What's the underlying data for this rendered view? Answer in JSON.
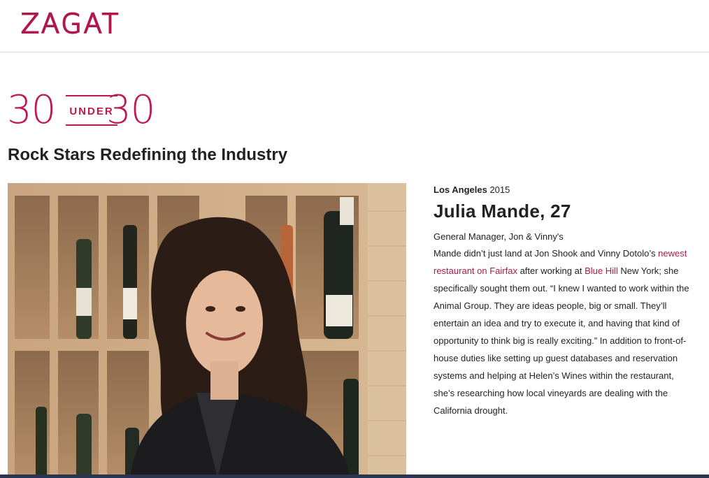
{
  "header": {
    "logo": "ZAGAT"
  },
  "badge": {
    "left_number": "30",
    "word": "UNDER",
    "right_number": "30"
  },
  "headline": "Rock Stars Redefining the Industry",
  "photo": {
    "icon": "portrait-photo"
  },
  "article": {
    "city": "Los Angeles",
    "year": "2015",
    "name": "Julia Mande, 27",
    "role": "General Manager, Jon & Vinny's",
    "body": {
      "p1": "Mande didn’t just land at Jon Shook and Vinny Dotolo’s ",
      "link1": "newest restaurant on Fairfax",
      "p2": " after working at ",
      "link2": "Blue Hill",
      "p3": " New York; she specifically sought them out. “I knew I wanted to work within the Animal Group. They are ideas people, big or small. They’ll entertain an idea and try to execute it, and having that kind of opportunity to think big is really exciting.” In addition to front-of-house duties like setting up guest databases and reservation systems and helping at Helen’s Wines within the restaurant, she’s researching how local vineyards are dealing with the California drought."
    }
  },
  "colors": {
    "brand": "#c0184f",
    "link": "#b0174d",
    "text": "#222222",
    "bottom_bar": "#2a3550"
  }
}
